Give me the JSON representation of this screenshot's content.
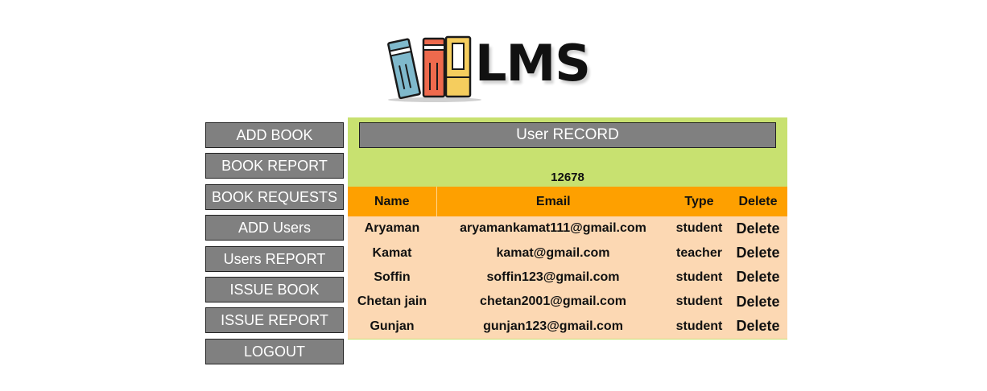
{
  "logo": {
    "text": "LMS"
  },
  "sidebar": {
    "items": [
      {
        "label": "ADD BOOK"
      },
      {
        "label": "BOOK REPORT"
      },
      {
        "label": "BOOK REQUESTS"
      },
      {
        "label": "ADD Users"
      },
      {
        "label": "Users REPORT"
      },
      {
        "label": "ISSUE BOOK"
      },
      {
        "label": "ISSUE REPORT"
      },
      {
        "label": "LOGOUT"
      }
    ]
  },
  "record": {
    "title": "User RECORD",
    "count": "12678",
    "columns": {
      "name": "Name",
      "email": "Email",
      "type": "Type",
      "delete": "Delete"
    },
    "rows": [
      {
        "name": "Aryaman",
        "email": "aryamankamat111@gmail.com",
        "type": "student",
        "action": "Delete"
      },
      {
        "name": "Kamat",
        "email": "kamat@gmail.com",
        "type": "teacher",
        "action": "Delete"
      },
      {
        "name": "Soffin",
        "email": "soffin123@gmail.com",
        "type": "student",
        "action": "Delete"
      },
      {
        "name": "Chetan jain",
        "email": "chetan2001@gmail.com",
        "type": "student",
        "action": "Delete"
      },
      {
        "name": "Gunjan",
        "email": "gunjan123@gmail.com",
        "type": "student",
        "action": "Delete"
      }
    ]
  },
  "colors": {
    "panel_bg": "#c8e170",
    "header_bg": "#fea000",
    "rows_bg": "#fcd8b3",
    "button_bg": "#808080"
  }
}
